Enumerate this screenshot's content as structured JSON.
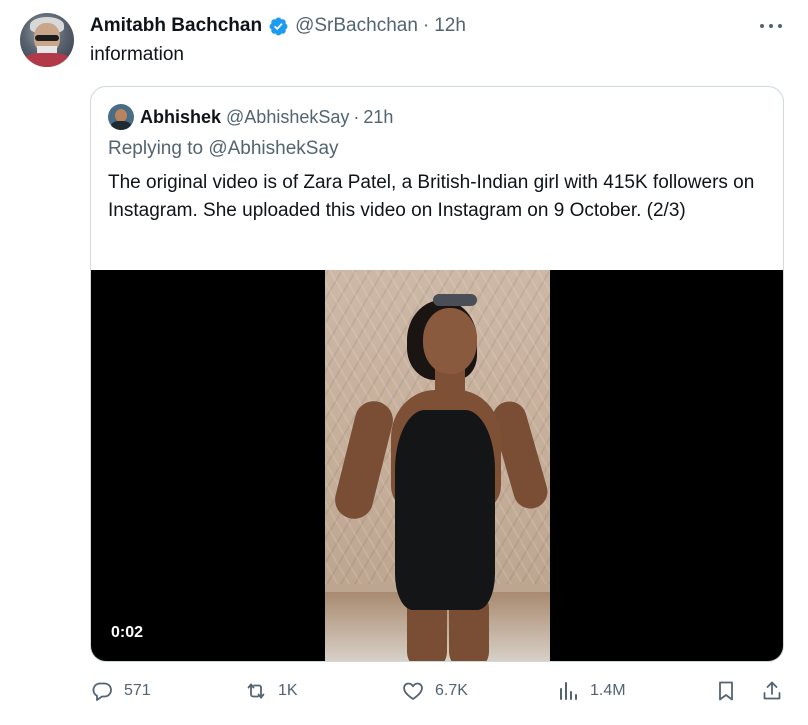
{
  "author": {
    "name": "Amitabh Bachchan",
    "handle": "@SrBachchan",
    "separator": "·",
    "time": "12h"
  },
  "text": "information",
  "quoted": {
    "name": "Abhishek",
    "handle": "@AbhishekSay",
    "separator": "·",
    "time": "21h",
    "replying_to": "Replying to @AbhishekSay",
    "text": "The original video is of Zara Patel, a British-Indian girl with 415K followers on Instagram. She uploaded this video on Instagram on 9 October. (2/3)",
    "video": {
      "duration": "0:02"
    }
  },
  "actions": {
    "replies": "571",
    "reposts": "1K",
    "likes": "6.7K",
    "views": "1.4M"
  },
  "colors": {
    "verified": "#1d9bf0",
    "text_primary": "#0f1419",
    "text_secondary": "#536471",
    "border": "#cfd9de"
  },
  "icons": [
    "verified-badge-icon",
    "more-icon",
    "reply-icon",
    "repost-icon",
    "like-icon",
    "views-icon",
    "bookmark-icon",
    "share-icon"
  ]
}
